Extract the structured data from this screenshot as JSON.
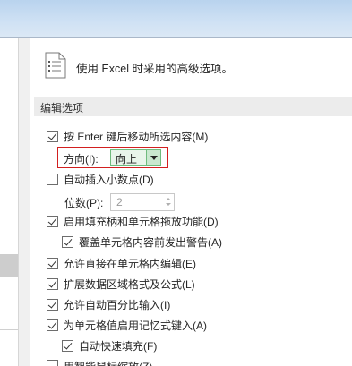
{
  "header": {
    "text": "使用 Excel 时采用的高级选项。",
    "icon": "options-page-icon"
  },
  "section": {
    "title": "编辑选项"
  },
  "options": {
    "enter_move": {
      "label": "按 Enter 键后移动所选内容(M)",
      "checked": true
    },
    "direction": {
      "label": "方向(I):",
      "value": "向上"
    },
    "auto_decimal": {
      "label": "自动插入小数点(D)",
      "checked": false
    },
    "places": {
      "label": "位数(P):",
      "value": "2"
    },
    "fill_handle": {
      "label": "启用填充柄和单元格拖放功能(D)",
      "checked": true
    },
    "overwrite_alert": {
      "label": "覆盖单元格内容前发出警告(A)",
      "checked": true
    },
    "edit_in_cell": {
      "label": "允许直接在单元格内编辑(E)",
      "checked": true
    },
    "extend_formats": {
      "label": "扩展数据区域格式及公式(L)",
      "checked": true
    },
    "auto_percent": {
      "label": "允许自动百分比输入(I)",
      "checked": true
    },
    "autocomplete": {
      "label": "为单元格值启用记忆式键入(A)",
      "checked": true
    },
    "flash_fill": {
      "label": "自动快速填充(F)",
      "checked": true
    },
    "intellimouse": {
      "label": "用智能鼠标缩放(Z)",
      "checked": false
    }
  },
  "colors": {
    "highlight_border": "#d21f1f",
    "select_bg": "#e8f5ea",
    "section_bg": "#ececec"
  }
}
